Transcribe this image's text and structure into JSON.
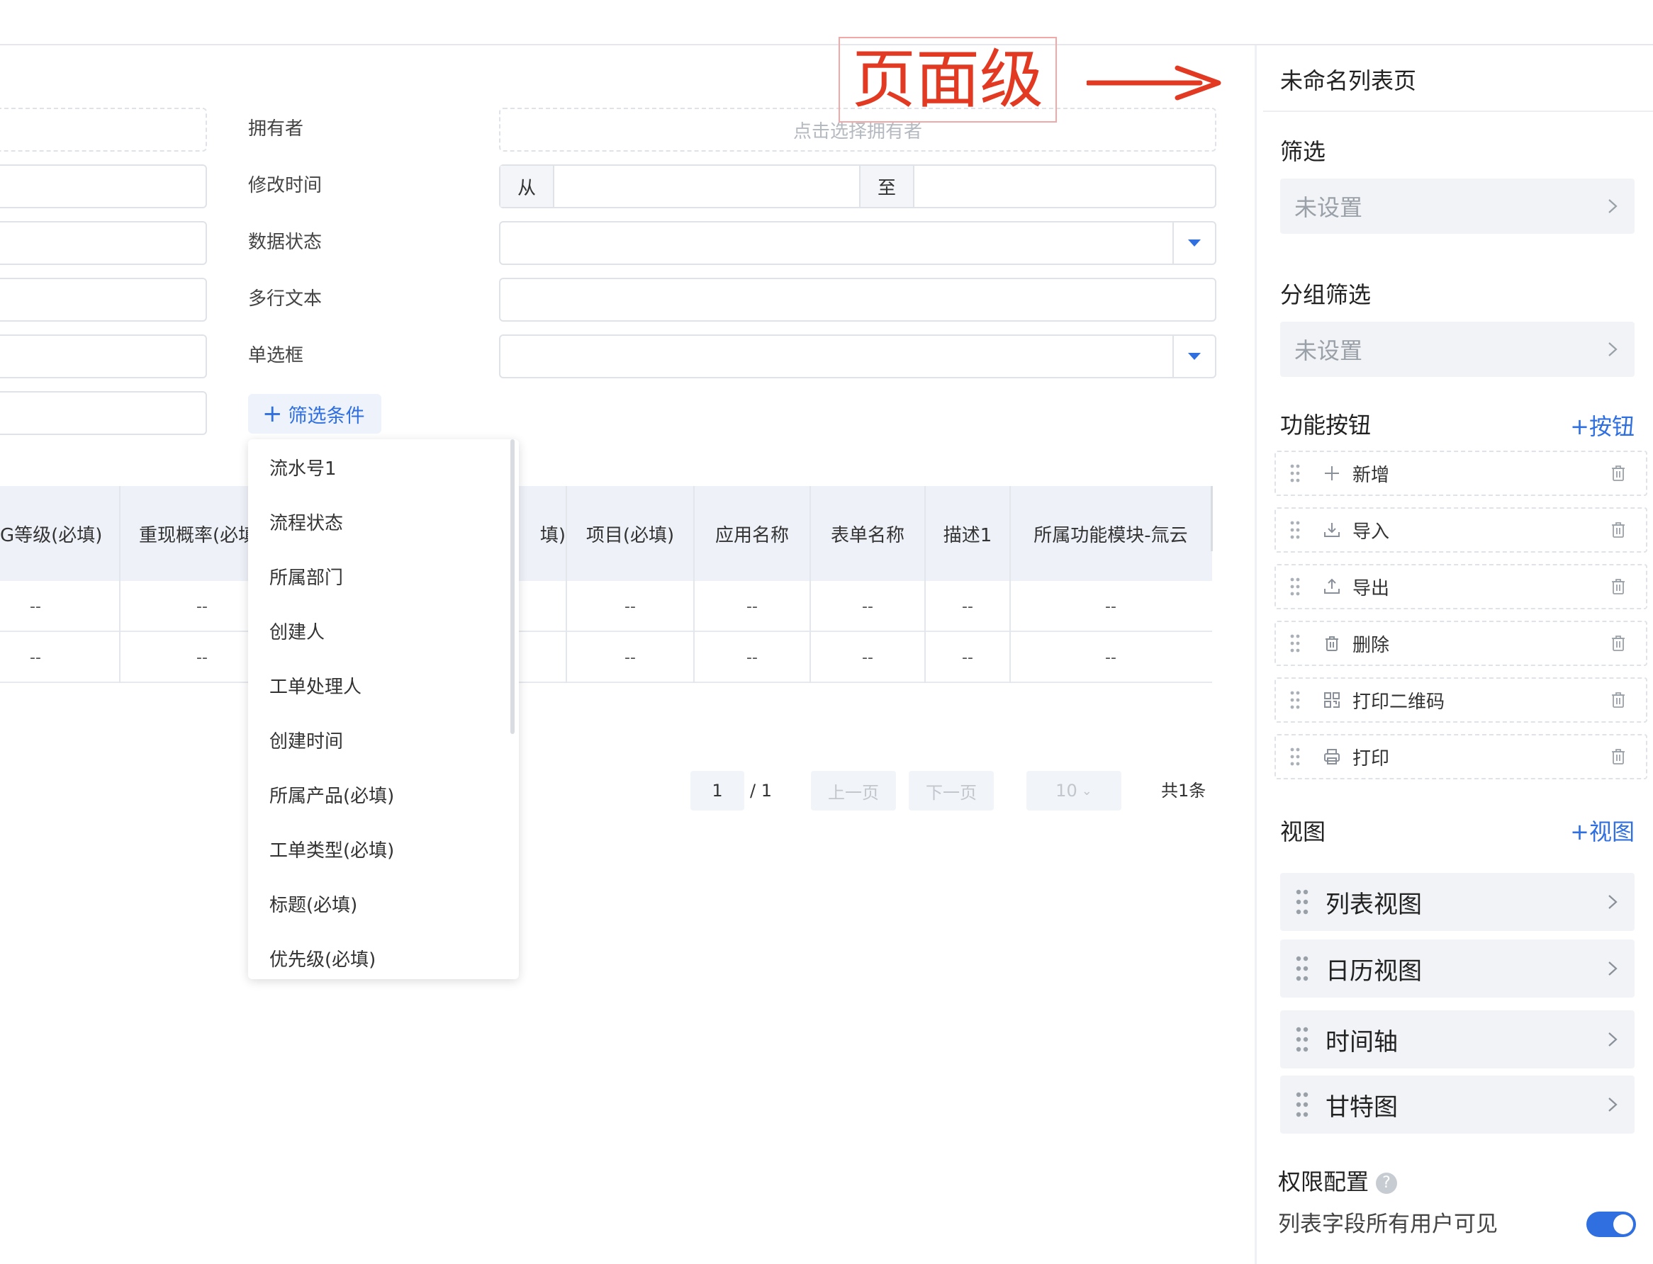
{
  "filters": {
    "owner": {
      "label": "拥有者",
      "placeholder": "点击选择拥有者"
    },
    "modified_time": {
      "label": "修改时间",
      "from": "从",
      "to": "至"
    },
    "data_status": {
      "label": "数据状态"
    },
    "multiline_text": {
      "label": "多行文本"
    },
    "radio": {
      "label": "单选框"
    },
    "add_condition": {
      "icon": "plus-icon",
      "label": "筛选条件"
    }
  },
  "dropdown": {
    "items": [
      "流水号1",
      "流程状态",
      "所属部门",
      "创建人",
      "工单处理人",
      "创建时间",
      "所属产品(必填)",
      "工单类型(必填)",
      "标题(必填)",
      "优先级(必填)"
    ]
  },
  "table": {
    "headers": [
      "G等级(必填)",
      "重现概率(必填)",
      "填)",
      "项目(必填)",
      "应用名称",
      "表单名称",
      "描述1",
      "所属功能模块-氚云"
    ],
    "empty_cell": "--"
  },
  "pagination": {
    "current": "1",
    "total": "/ 1",
    "prev": "上一页",
    "next": "下一页",
    "page_size": "10",
    "count": "共1条"
  },
  "annotation": {
    "text": "页面级",
    "color": "#e23a22"
  },
  "sidebar": {
    "title": "未命名列表页",
    "filter": {
      "title": "筛选",
      "value": "未设置"
    },
    "group_filter": {
      "title": "分组筛选",
      "value": "未设置"
    },
    "function_buttons": {
      "title": "功能按钮",
      "add": "+按钮",
      "items": [
        {
          "label": "新增",
          "icon": "plus-icon"
        },
        {
          "label": "导入",
          "icon": "import-icon"
        },
        {
          "label": "导出",
          "icon": "export-icon"
        },
        {
          "label": "删除",
          "icon": "trash-icon"
        },
        {
          "label": "打印二维码",
          "icon": "qrcode-icon"
        },
        {
          "label": "打印",
          "icon": "printer-icon"
        }
      ]
    },
    "views": {
      "title": "视图",
      "add": "+视图",
      "items": [
        "列表视图",
        "日历视图",
        "时间轴",
        "甘特图"
      ]
    },
    "permissions": {
      "title": "权限配置",
      "help_icon": "?",
      "toggle_label": "列表字段所有用户可见",
      "toggle_on": true
    }
  },
  "colors": {
    "accent": "#2f6fe0",
    "annotation": "#e23a22"
  }
}
